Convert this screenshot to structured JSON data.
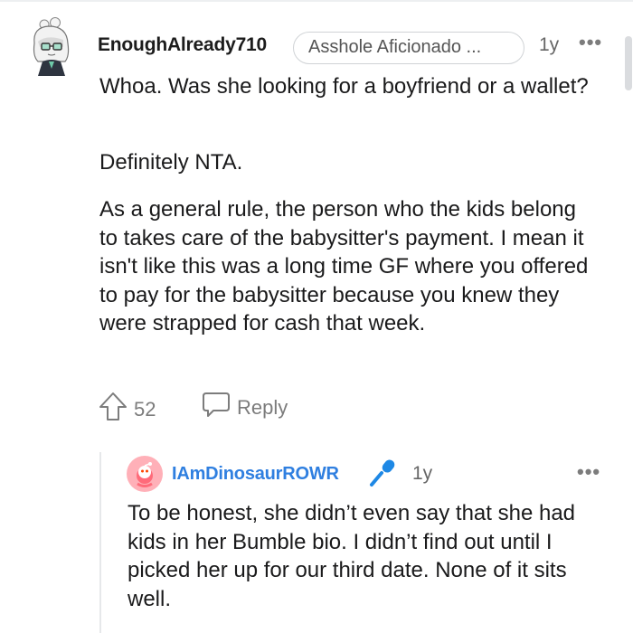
{
  "comment": {
    "author": "EnoughAlready710",
    "flair": "Asshole Aficionado ...",
    "age": "1y",
    "more": "•••",
    "paragraphs": [
      "Whoa. Was she looking for a boyfriend or a wallet?",
      "Definitely NTA.",
      "As a general rule, the person who the kids belong to takes care of the babysitter's payment. I mean it isn't like this was a long time GF where you offered to pay for the babysitter because you knew they were strapped for cash that week."
    ],
    "upvotes": "52",
    "reply_label": "Reply"
  },
  "reply": {
    "author": "IAmDinosaurROWR",
    "age": "1y",
    "more": "•••",
    "text": "To be honest, she didn’t even say that she had kids in her Bumble bio. I didn’t find out until I picked her up for our third date. None of it sits well."
  },
  "colors": {
    "username_reply": "#2f7fe0",
    "mic_badge": "#1e88e5",
    "avatar_bg": "#ffb0b8",
    "muted": "#7c7c7c"
  }
}
